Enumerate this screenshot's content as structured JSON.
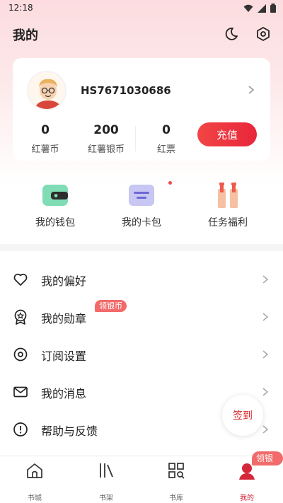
{
  "status_bar": {
    "time": "12:18"
  },
  "header": {
    "title": "我的"
  },
  "profile": {
    "username": "HS7671030686",
    "stats": [
      {
        "value": "0",
        "label": "红薯币"
      },
      {
        "value": "200",
        "label": "红薯银币"
      },
      {
        "value": "0",
        "label": "红票"
      }
    ],
    "recharge_label": "充值"
  },
  "quick_actions": [
    {
      "label": "我的钱包",
      "icon": "wallet-icon"
    },
    {
      "label": "我的卡包",
      "icon": "card-pack-icon"
    },
    {
      "label": "任务福利",
      "icon": "gift-icon"
    }
  ],
  "menu": [
    {
      "label": "我的偏好",
      "icon": "heart-icon"
    },
    {
      "label": "我的勋章",
      "icon": "medal-icon",
      "badge": "领银币"
    },
    {
      "label": "订阅设置",
      "icon": "settings-icon"
    },
    {
      "label": "我的消息",
      "icon": "mail-icon"
    },
    {
      "label": "帮助与反馈",
      "icon": "help-icon"
    }
  ],
  "checkin_label": "签到",
  "tabbar": {
    "tabs": [
      {
        "label": "书城",
        "icon": "bookstore-icon"
      },
      {
        "label": "书架",
        "icon": "bookshelf-icon"
      },
      {
        "label": "书库",
        "icon": "library-icon"
      },
      {
        "label": "我的",
        "icon": "profile-icon"
      }
    ],
    "badge": "领银币",
    "active_color": "#d4283a"
  },
  "colors": {
    "accent": "#e8263a",
    "badge": "#f26a6a"
  }
}
